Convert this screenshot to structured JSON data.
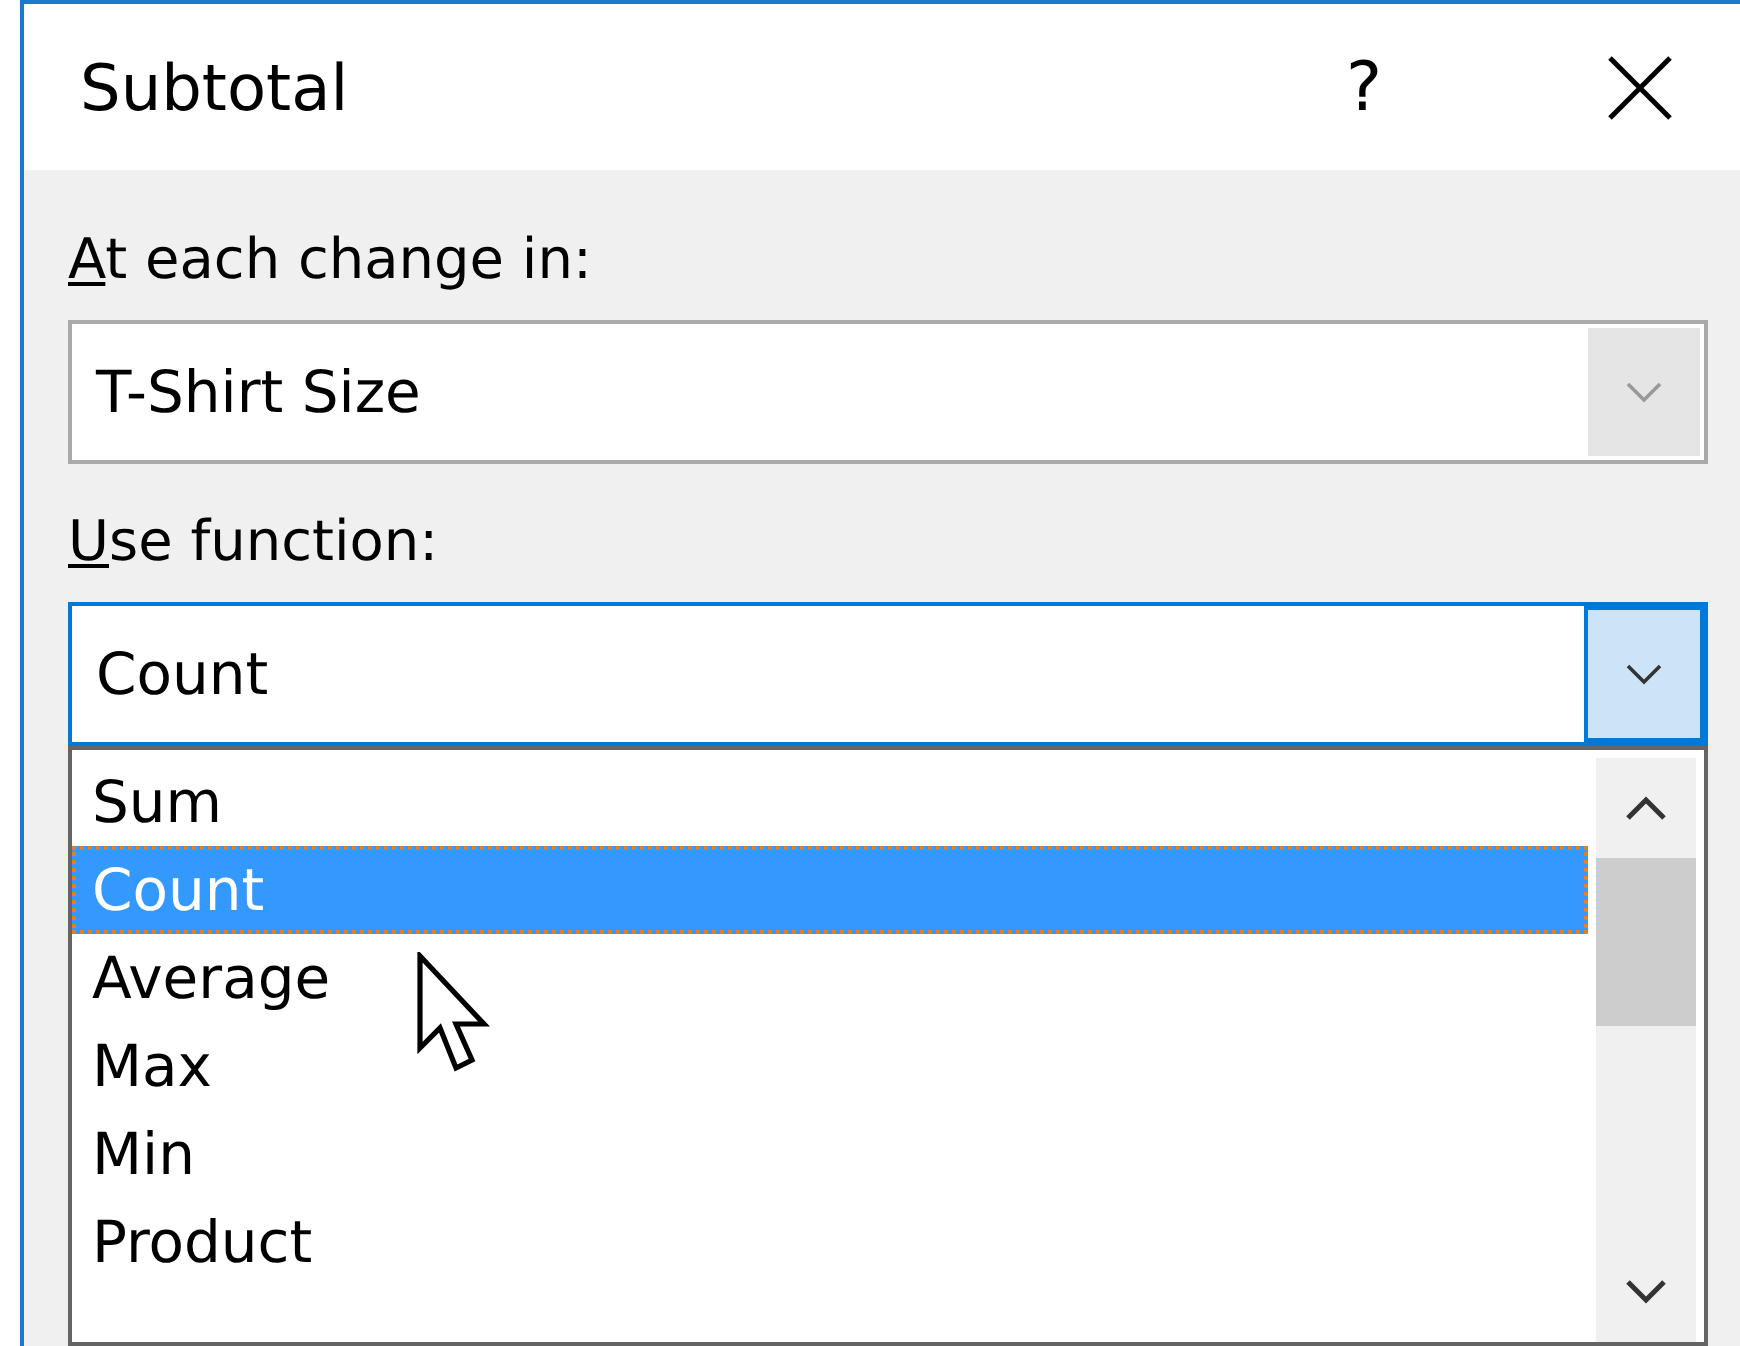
{
  "window": {
    "title": "Subtotal",
    "help": "?"
  },
  "fields": [
    {
      "label": "At each change in:",
      "value": "T-Shirt Size",
      "focused": false
    },
    {
      "label": "Use function:",
      "value": "Count",
      "focused": true,
      "expanded": true,
      "options": [
        {
          "label": "Sum",
          "selected": false
        },
        {
          "label": "Count",
          "selected": true
        },
        {
          "label": "Average",
          "selected": false
        },
        {
          "label": "Max",
          "selected": false
        },
        {
          "label": "Min",
          "selected": false
        },
        {
          "label": "Product",
          "selected": false
        }
      ]
    }
  ]
}
